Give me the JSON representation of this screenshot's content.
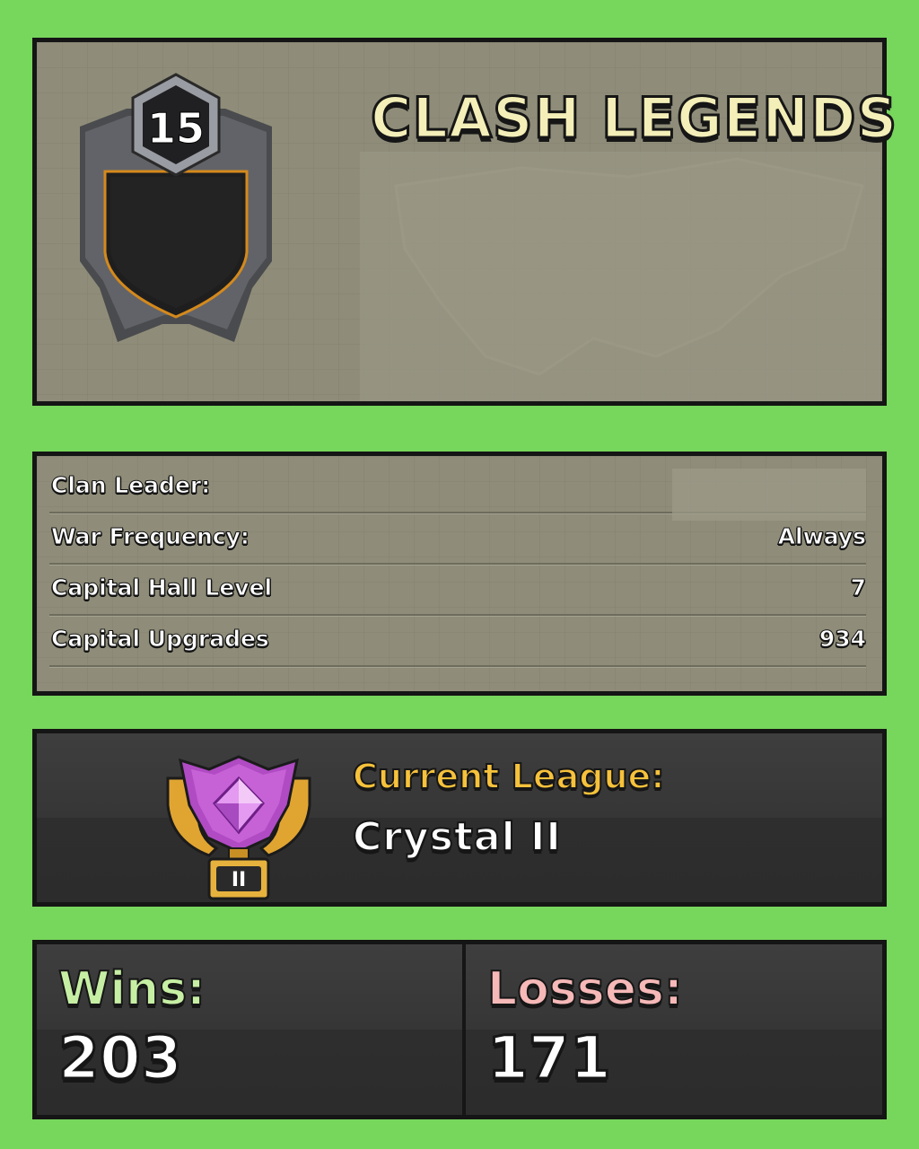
{
  "clan": {
    "name": "CLASH LEGENDS",
    "level": "15"
  },
  "info": {
    "rows": [
      {
        "label": "Clan Leader:",
        "value": ""
      },
      {
        "label": "War Frequency:",
        "value": "Always"
      },
      {
        "label": "Capital Hall Level",
        "value": "7"
      },
      {
        "label": "Capital Upgrades",
        "value": "934"
      }
    ]
  },
  "league": {
    "title": "Current League:",
    "value": "Crystal II",
    "rank_numeral": "II"
  },
  "record": {
    "wins_label": "Wins:",
    "wins_value": "203",
    "losses_label": "Losses:",
    "losses_value": "171"
  },
  "colors": {
    "background": "#77d65c",
    "clan_name": "#f4efb8",
    "league_title": "#f7c23b",
    "wins_label": "#c6efa4",
    "losses_label": "#f6b9b8",
    "map": "#8f8d79"
  },
  "icons": [
    "clan-badge-icon",
    "crystal-league-icon"
  ]
}
